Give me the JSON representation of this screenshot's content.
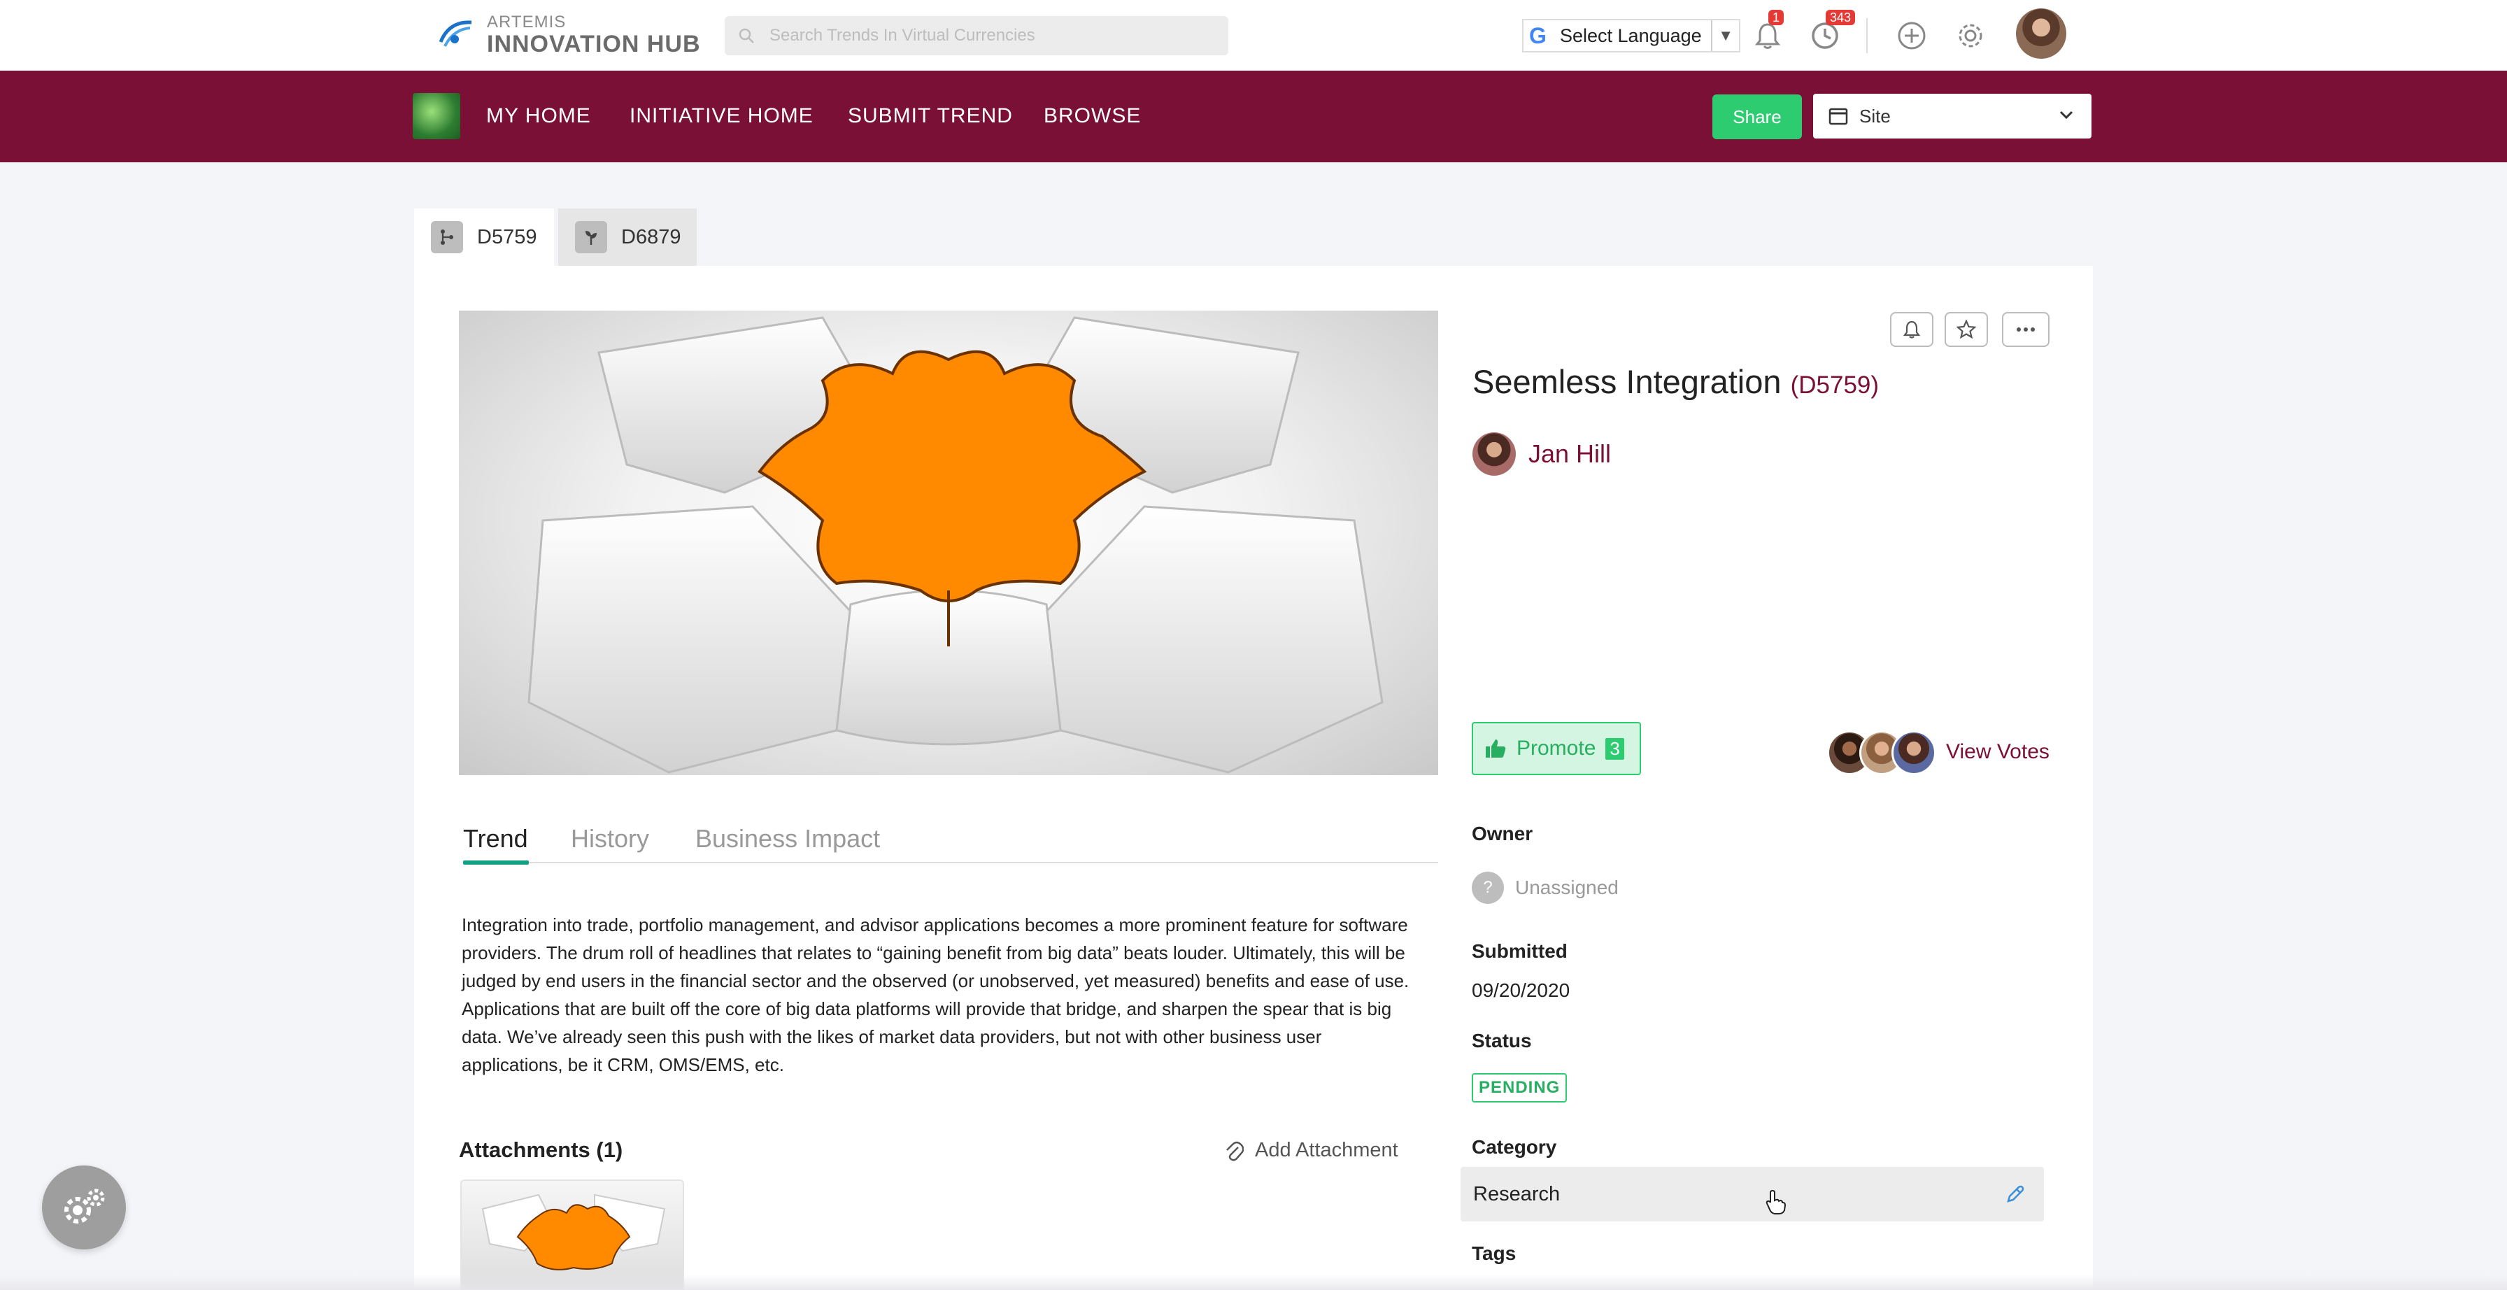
{
  "header": {
    "logo_line1": "ARTEMIS",
    "logo_line2": "INNOVATION HUB",
    "search_placeholder": "Search Trends In Virtual Currencies",
    "language_label": "Select Language",
    "notifications_count": "1",
    "activity_count": "343",
    "icons": [
      "search-icon",
      "bell-icon",
      "activity-icon",
      "plus-icon",
      "gear-icon"
    ]
  },
  "nav": {
    "items": [
      "MY HOME",
      "INITIATIVE HOME",
      "SUBMIT TREND",
      "BROWSE"
    ],
    "share_label": "Share",
    "site_label": "Site"
  },
  "page_tabs": [
    "D5759",
    "D6879"
  ],
  "trend": {
    "title": "Seemless Integration",
    "code": "(D5759)",
    "author": "Jan Hill",
    "tabs": [
      "Trend",
      "History",
      "Business Impact"
    ],
    "description": "Integration into trade, portfolio management, and advisor applications becomes a more prominent feature for software providers. The drum roll of headlines that relates to “gaining benefit from big data” beats louder. Ultimately, this will be judged by end users in the financial sector and the observed (or unobserved, yet measured) benefits and ease of use. Applications that are built off the core of big data platforms will provide that bridge, and sharpen the spear that is big data. We’ve already seen this push with the likes of market data providers, but not with other business user applications, be it CRM, OMS/EMS, etc.",
    "attachments_label": "Attachments (1)",
    "add_attachment_label": "Add Attachment",
    "promote_label": "Promote",
    "promote_count": "3",
    "view_votes_label": "View Votes"
  },
  "details": {
    "owner_label": "Owner",
    "owner_value": "Unassigned",
    "submitted_label": "Submitted",
    "submitted_value": "09/20/2020",
    "status_label": "Status",
    "status_value": "PENDING",
    "category_label": "Category",
    "category_value": "Research",
    "tags_label": "Tags"
  },
  "colors": {
    "brand": "#7a1035",
    "accent_green": "#2ecc71",
    "tab_underline": "#14a085",
    "puzzle_orange": "#ff8a00"
  }
}
